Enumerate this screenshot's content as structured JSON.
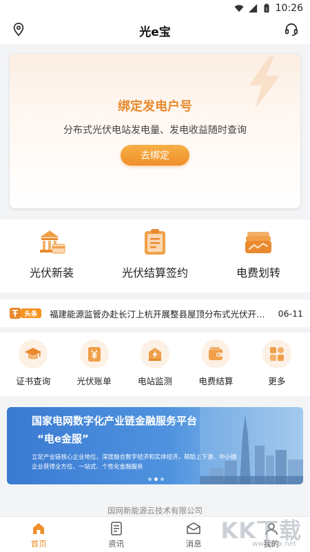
{
  "status_bar": {
    "time": "10:26",
    "wifi_icon": "wifi-icon",
    "battery_icon": "battery-icon"
  },
  "header": {
    "title": "光e宝",
    "left_icon": "location-pin-icon",
    "right_icon": "headset-icon"
  },
  "bind_card": {
    "title": "绑定发电户号",
    "description": "分布式光伏电站发电量、发电收益随时查询",
    "button_label": "去绑定",
    "accent": "#e88a2d"
  },
  "services": [
    {
      "label": "光伏新装",
      "icon": "bank-card-icon"
    },
    {
      "label": "光伏结算签约",
      "icon": "clipboard-icon"
    },
    {
      "label": "电费划转",
      "icon": "wallet-stack-icon"
    }
  ],
  "news": {
    "badge_text": "头条",
    "headline": "福建能源监管办赴长汀上杭开展整县屋顶分布式光伏开发试点工作",
    "date": "06-11"
  },
  "quick_actions": [
    {
      "label": "证书查询",
      "icon": "graduation-cap-icon"
    },
    {
      "label": "光伏账单",
      "icon": "yuan-bill-icon"
    },
    {
      "label": "电站监测",
      "icon": "power-station-icon"
    },
    {
      "label": "电费结算",
      "icon": "wallet-icon"
    },
    {
      "label": "更多",
      "icon": "grid-more-icon"
    }
  ],
  "banner": {
    "title": "国家电网数字化产业链金融服务平台",
    "subtitle": "“电e金服”",
    "description": "立足产业链核心企业地位，深度融合数字经济和实体经济，帮助上下游、中小微企业获得全方位、一站式、个性化金融服务",
    "active_slide": 1,
    "slide_count": 3
  },
  "footer": {
    "company": "国网新能源云技术有限公司"
  },
  "tabs": [
    {
      "label": "首页",
      "icon": "home-icon",
      "active": true
    },
    {
      "label": "资讯",
      "icon": "document-icon",
      "active": false
    },
    {
      "label": "消息",
      "icon": "message-icon",
      "active": false
    },
    {
      "label": "我的",
      "icon": "user-icon",
      "active": false
    }
  ],
  "watermark": {
    "text": "KK下载",
    "url": "www.kkx.net"
  },
  "colors": {
    "accent": "#ef8f2a",
    "banner_blue": "#3a7ad2"
  }
}
